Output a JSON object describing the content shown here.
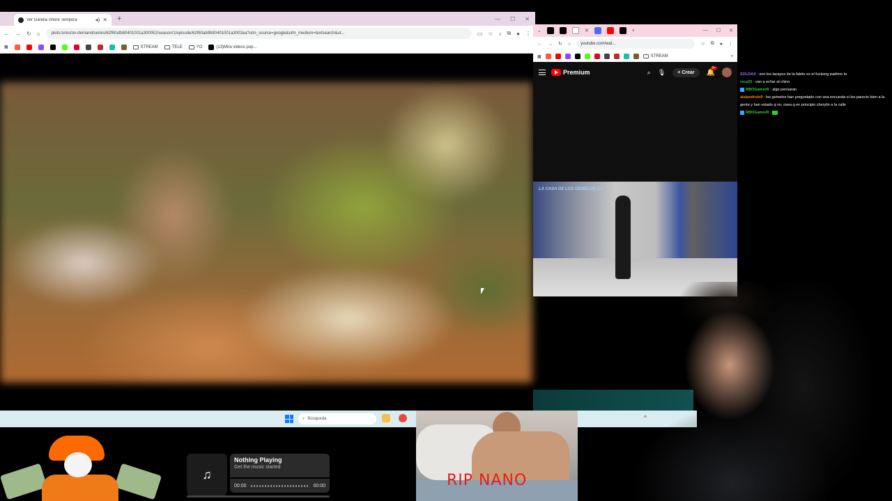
{
  "left_browser": {
    "tab_title": "Ver Gandia Shore Tempora",
    "url": "pluto.tv/es/on-demand/series/62f60afb80401001a300052/season/1/episode/62f60ab9b80401001a3002ea?utm_source=google&utm_medium=textsearch&ut...",
    "bookmarks": [
      "STREAM",
      "TELE",
      "YO",
      "(13)Mira videos pop..."
    ]
  },
  "right_browser": {
    "url": "youtube.com/wat...",
    "bookmark_folder": "STREAM",
    "logo_text": "Premium",
    "create_label": "Crear",
    "notif_count": "9+",
    "video_logo": "LA CASA DE LOS GEMELOS 2.0"
  },
  "chat": [
    {
      "user": "SOLDAX",
      "sep": " : ",
      "msg": "son los lacayos de la falete es el fuckong padrino tu"
    },
    {
      "user": "raca55",
      "sep": " : ",
      "msg": "van a echar al chino"
    },
    {
      "user": "RBOGamerR",
      "sep": " : ",
      "msg": "algo pensaran"
    },
    {
      "user": "alejandrolo9",
      "sep": " : ",
      "msg": "los gemelos han preguntado con una encuesta si les parecio bien a la gente y han votado q no, osea q en principio cherylin a la calle"
    },
    {
      "user": "RBOGamerR",
      "sep": " : ",
      "msg": ""
    }
  ],
  "taskbar": {
    "search_placeholder": "Búsqueda"
  },
  "music": {
    "title": "Nothing Playing",
    "subtitle": "Get the music started",
    "time_start": "00:00",
    "time_end": "00:00",
    "progress": 0
  },
  "rip_text": "RIP NANO",
  "colors": {
    "tab_strip": "#e8d5e6",
    "yt_red": "#ff0000",
    "taskbar": "#d9ecf0",
    "rip_red": "#e0201c"
  }
}
